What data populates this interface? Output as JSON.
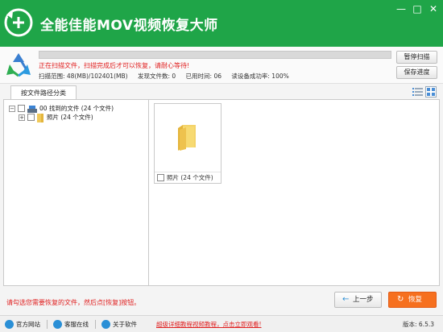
{
  "app": {
    "title": "全能佳能MOV视频恢复大师",
    "colors": {
      "titlebar": "#1fa548",
      "accent_orange": "#f6701f",
      "warning_red": "#e02020",
      "link_blue": "#2a8fd6"
    }
  },
  "window": {
    "minimize": "—",
    "maximize": "□",
    "close": "✕"
  },
  "scan": {
    "progress_percent": 100,
    "message": "正在扫描文件，扫描完成后才可以恢复，请耐心等待!",
    "range": "扫描范围: 48(MB)/102401(MB)",
    "found": "发现文件数: 0",
    "elapsed": "已用时间: 06",
    "success_rate": "读设备成功率: 100%",
    "pause_button": "暂停扫描",
    "save_button": "保存进度"
  },
  "tabs": {
    "active": "按文件路径分类"
  },
  "tree": {
    "root": {
      "label": "00 找到的文件 (24 个文件)",
      "expand": "−"
    },
    "child": {
      "label": "照片    (24 个文件)",
      "expand": "+"
    }
  },
  "grid": {
    "items": [
      {
        "label": "照片 (24 个文件)",
        "icon": "folder-icon"
      }
    ]
  },
  "footer": {
    "hint": "请勾选您需要恢复的文件，然后点[恢复]按钮。",
    "prev_button": "上一步",
    "prev_arrow": "←",
    "recover_button": "恢复",
    "recover_arrow": "↻"
  },
  "statusbar": {
    "official_site": "官方网站",
    "customer_service": "客服在线",
    "about": "关于软件",
    "tutorial_link": "超级详细教程视频教程，点击立即观看!",
    "version": "版本: 6.5.3"
  }
}
